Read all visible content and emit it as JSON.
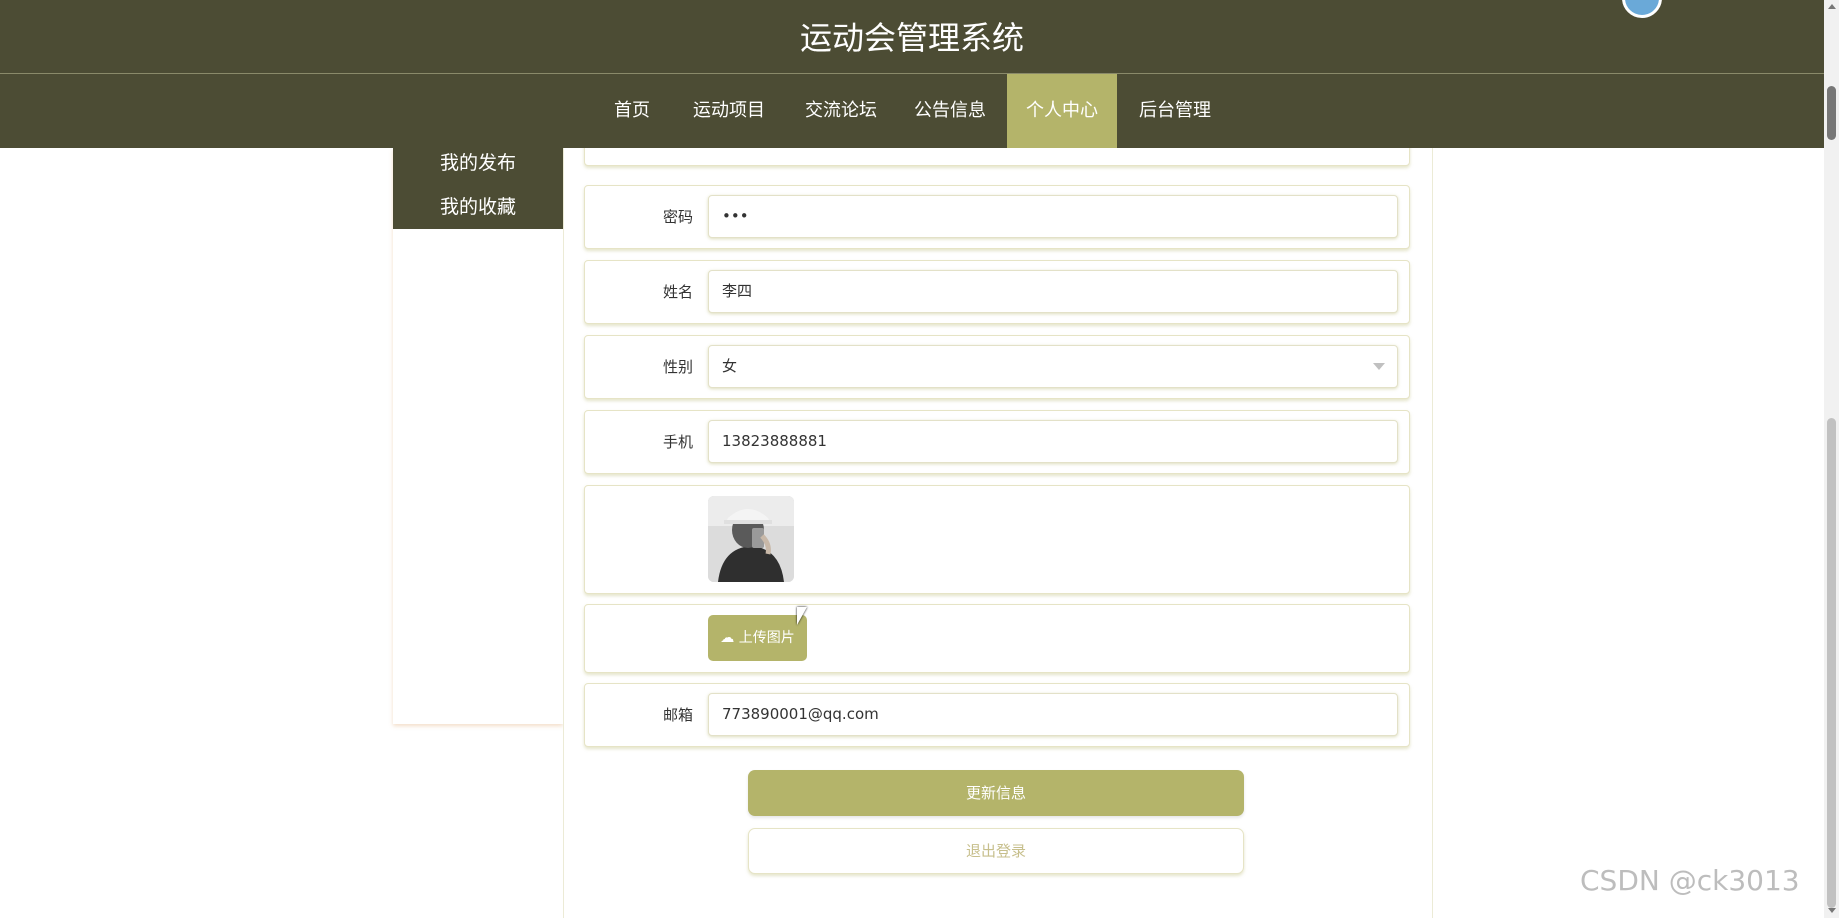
{
  "app": {
    "title": "运动会管理系统"
  },
  "nav": {
    "items": [
      {
        "label": "首页"
      },
      {
        "label": "运动项目"
      },
      {
        "label": "交流论坛"
      },
      {
        "label": "公告信息"
      },
      {
        "label": "个人中心",
        "active": true
      },
      {
        "label": "后台管理"
      }
    ]
  },
  "sidebar": {
    "items": [
      {
        "label": "我的发布"
      },
      {
        "label": "我的收藏"
      }
    ]
  },
  "form": {
    "password": {
      "label": "密码",
      "value": "•••"
    },
    "name": {
      "label": "姓名",
      "value": "李四"
    },
    "gender": {
      "label": "性别",
      "value": "女"
    },
    "phone": {
      "label": "手机",
      "value": "13823888881"
    },
    "upload_label": "上传图片",
    "email": {
      "label": "邮箱",
      "value": "773890001@qq.com"
    }
  },
  "buttons": {
    "update": "更新信息",
    "logout": "退出登录"
  },
  "watermark": "CSDN @ck3013",
  "colors": {
    "header": "#4c4c34",
    "accent": "#b4b46a",
    "scrollbar": "#f1f1f1"
  }
}
